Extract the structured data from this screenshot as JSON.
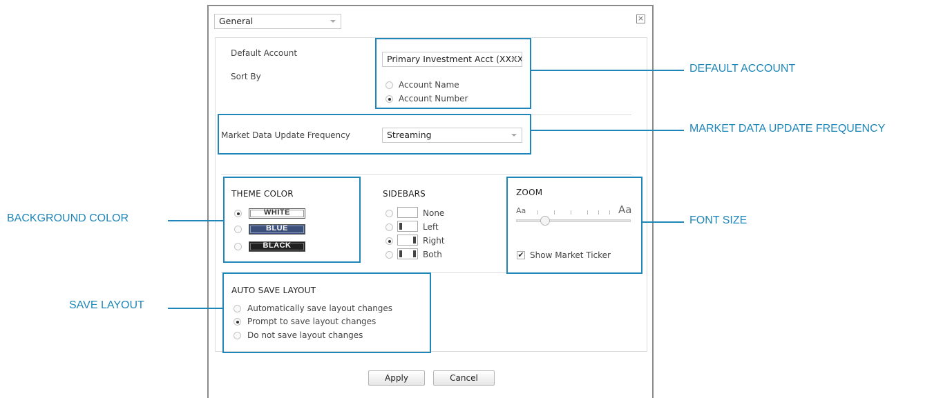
{
  "dialog": {
    "category_select": "General",
    "close_glyph": "×"
  },
  "account": {
    "default_account_label": "Default Account",
    "sort_by_label": "Sort By",
    "account_select": "Primary Investment Acct (XXXX",
    "sort_options": [
      "Account Name",
      "Account Number"
    ],
    "sort_selected": "Account Number"
  },
  "market_data": {
    "label": "Market Data Update Frequency",
    "select": "Streaming"
  },
  "theme": {
    "header": "THEME COLOR",
    "options": [
      "WHITE",
      "BLUE",
      "BLACK"
    ],
    "selected": "WHITE",
    "colors": {
      "white": "#ffffff",
      "blue": "#3b4f7a",
      "black": "#1f1f1f"
    }
  },
  "sidebars": {
    "header": "SIDEBARS",
    "options": [
      "None",
      "Left",
      "Right",
      "Both"
    ],
    "selected": "Right"
  },
  "zoom": {
    "header": "ZOOM",
    "small_label": "Aa",
    "large_label": "Aa",
    "level_fraction": 0.25,
    "show_ticker_label": "Show Market Ticker",
    "show_ticker_checked": true,
    "check_glyph": "✔"
  },
  "autosave": {
    "header": "AUTO SAVE LAYOUT",
    "options": [
      "Automatically save layout changes",
      "Prompt to save layout changes",
      "Do not save layout changes"
    ],
    "selected": "Prompt to save layout changes"
  },
  "buttons": {
    "apply": "Apply",
    "cancel": "Cancel"
  },
  "callouts": {
    "default_account": "DEFAULT ACCOUNT",
    "market_data": "MARKET DATA UPDATE FREQUENCY",
    "background_color": "BACKGROUND COLOR",
    "font_size": "FONT SIZE",
    "save_layout": "SAVE LAYOUT"
  },
  "accent_color": "#1e86b8"
}
